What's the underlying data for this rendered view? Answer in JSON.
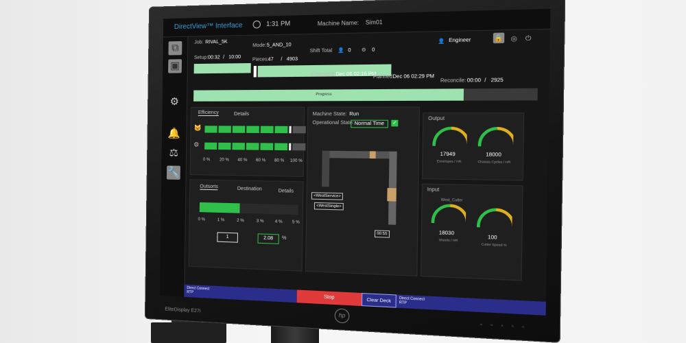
{
  "app": {
    "title": "DirectView™ Interface",
    "time": "1:31 PM",
    "machine_name_label": "Machine Name:",
    "machine_name": "Sim01",
    "user": "Engineer"
  },
  "job": {
    "job_label": "Job:",
    "job": "RIVAL_5K",
    "mode_label": "Mode:",
    "mode": "5_AND_10",
    "shift_total_label": "Shift Total",
    "shift_a": "0",
    "shift_b": "0",
    "setup_label": "Setup:",
    "setup_current": "00:32",
    "setup_sep": "/",
    "setup_total": "10:00",
    "pieces_label": "Pieces:",
    "pieces_current": "47",
    "pieces_sep": "/",
    "pieces_total": "4903",
    "estimated_label": "Estimated:",
    "estimated": "Dec 06 02:16 PM",
    "planned_label": "Planned:",
    "planned": "Dec 06 02:29 PM",
    "reconcile_label": "Reconcile:",
    "reconcile_current": "00:00",
    "reconcile_sep": "/",
    "reconcile_total": "2925",
    "progress_label": "Progress",
    "setup_fraction": 0.3,
    "pieces_fraction": 0.01,
    "progress_fraction": 0.8
  },
  "efficiency": {
    "tabs": [
      "Efficiency",
      "Details"
    ],
    "ticks": [
      "0 %",
      "20 %",
      "40 %",
      "60 %",
      "80 %",
      "100 %"
    ],
    "row1_fraction": 0.8,
    "row2_fraction": 0.8
  },
  "outsorts": {
    "tabs": [
      "Outsorts",
      "Destination",
      "Details"
    ],
    "ticks": [
      "0 %",
      "1 %",
      "2 %",
      "3 %",
      "4 %",
      "5 %"
    ],
    "fill_fraction": 0.416,
    "count": "1",
    "percent": "2.08",
    "percent_unit": "%"
  },
  "machine": {
    "state_label": "Machine State:",
    "state": "Run",
    "op_state_label": "Operational State:",
    "op_state": "Normal Time",
    "node1": "<WestService>",
    "node2": "<WestSingle>",
    "node3": "00:55"
  },
  "output": {
    "title": "Output",
    "g1_value": "17949",
    "g1_label": "Envelopes / HR",
    "g2_value": "18000",
    "g2_label": "Chassis Cycles / HR"
  },
  "input": {
    "title": "Input",
    "device": "West_Cutter",
    "g1_value": "18030",
    "g1_label": "Sheets / HR",
    "g2_value": "100",
    "g2_label": "Cutter Speed %"
  },
  "bottom": {
    "left_line1": "Direct Connect",
    "left_line2": "RTP",
    "stop": "Stop",
    "clear": "Clear Deck",
    "right_line1": "Direct Connect",
    "right_line2": "RTP"
  },
  "monitor": {
    "model": "EliteDisplay E27i"
  },
  "colors": {
    "accent": "#2f9fd8",
    "bar_green": "#2fbf4a",
    "progress": "#9ee2b0",
    "stop_red": "#e03a3a",
    "bottom_blue": "#2a2d8a"
  }
}
